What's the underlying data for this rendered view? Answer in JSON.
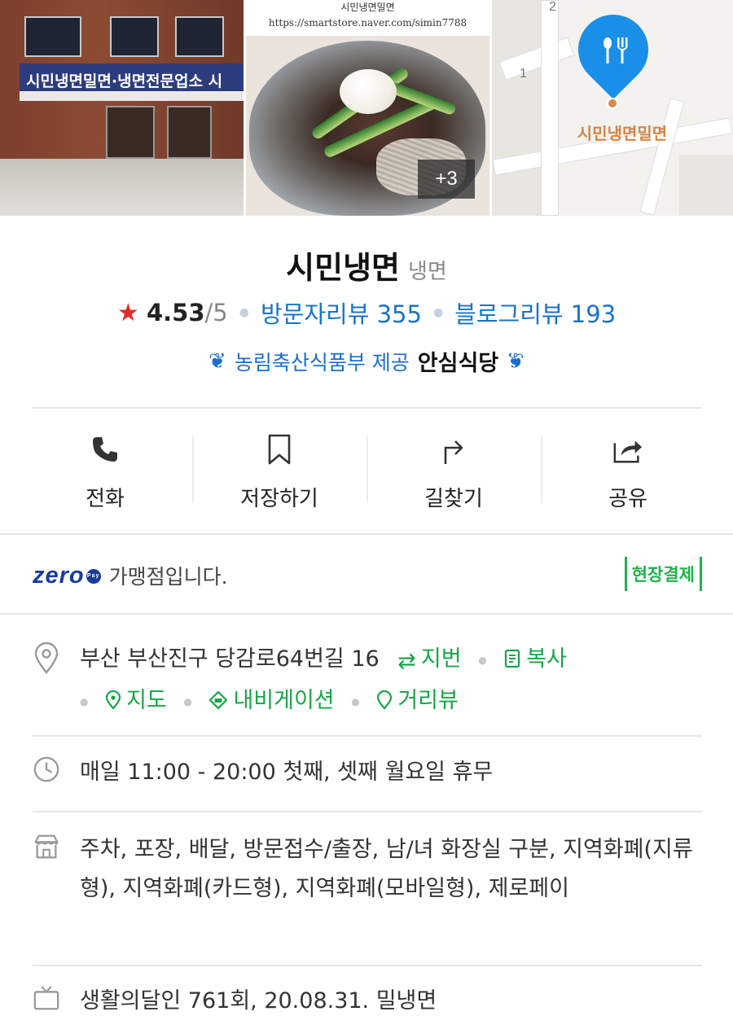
{
  "photos": {
    "storefront_sign": "시민냉면밀면·냉면전문업소 시",
    "dish_caption_title": "시민냉면밀면",
    "dish_caption_url": "https://smartstore.naver.com/simin7788",
    "more_count": "+3",
    "map_place_label": "시민냉면밀면",
    "map_block_numbers": [
      "2",
      "1"
    ]
  },
  "place": {
    "name": "시민냉면",
    "category": "냉면"
  },
  "stats": {
    "rating": "4.53",
    "rating_max": "/5",
    "visitor_reviews": "방문자리뷰 355",
    "blog_reviews": "블로그리뷰 193"
  },
  "badge": {
    "provider": "농림축산식품부 제공",
    "name": "안심식당"
  },
  "actions": [
    {
      "label": "전화",
      "icon": "phone-icon"
    },
    {
      "label": "저장하기",
      "icon": "bookmark-icon"
    },
    {
      "label": "길찾기",
      "icon": "directions-icon"
    },
    {
      "label": "공유",
      "icon": "share-icon"
    }
  ],
  "zeropay": {
    "logo": "zero",
    "logo_sub": "Pay",
    "text": "가맹점입니다.",
    "onsite_label": "현장결제"
  },
  "address": {
    "text": "부산 부산진구 당감로64번길 16",
    "jibun": "지번",
    "copy": "복사",
    "map": "지도",
    "navigation": "내비게이션",
    "street_view": "거리뷰"
  },
  "hours": {
    "text": "매일 11:00 - 20:00 첫째, 셋째 월요일 휴무"
  },
  "amenities": {
    "text": "주차, 포장, 배달, 방문접수/출장, 남/녀 화장실 구분, 지역화폐(지류형), 지역화폐(카드형), 지역화폐(모바일형), 제로페이"
  },
  "tv": {
    "text": "생활의달인 761회, 20.08.31. 밀냉면"
  },
  "colors": {
    "accent_blue": "#1a73c8",
    "green": "#18a548",
    "star_red": "#e42b2b",
    "map_pin": "#1a8fe8"
  }
}
